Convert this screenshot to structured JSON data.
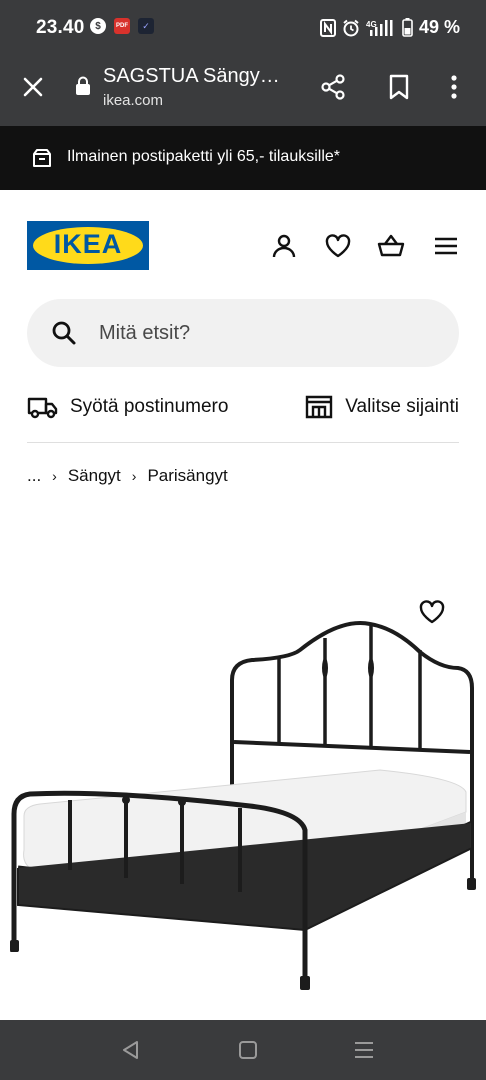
{
  "status_bar": {
    "time": "23.40",
    "battery": "49 %",
    "network": "4G",
    "left_icons": [
      "dollar-icon",
      "pdf-icon",
      "mail-icon"
    ],
    "right_icons": [
      "nfc-icon",
      "alarm-icon",
      "signal-icon",
      "battery-icon"
    ]
  },
  "browser": {
    "title": "SAGSTUA Sängy…",
    "url": "ikea.com",
    "actions": [
      "close-icon",
      "share-icon",
      "bookmark-icon",
      "overflow-menu-icon"
    ]
  },
  "promo": {
    "text": "Ilmainen postipaketti yli 65,- tilauksille*",
    "icon": "parcel-icon"
  },
  "header": {
    "logo_text": "IKEA",
    "icons": [
      "account-icon",
      "wishlist-icon",
      "basket-icon",
      "hamburger-menu-icon"
    ]
  },
  "search": {
    "placeholder": "Mitä etsit?",
    "value": ""
  },
  "delivery": {
    "postcode_label": "Syötä postinumero",
    "location_label": "Valitse sijainti"
  },
  "breadcrumb": {
    "items": [
      "...",
      "Sängyt",
      "Parisängyt"
    ]
  },
  "product": {
    "image_icon": "bed-image",
    "favorite_icon": "heart-icon"
  },
  "colors": {
    "status_bar_bg": "#3a3b3d",
    "promo_bg": "#111111",
    "ikea_blue": "#0058a3",
    "ikea_yellow": "#ffda1a",
    "search_bg": "#f1f1f1"
  },
  "nav_bar": {
    "buttons": [
      "back-icon",
      "home-icon",
      "recent-apps-icon"
    ]
  }
}
